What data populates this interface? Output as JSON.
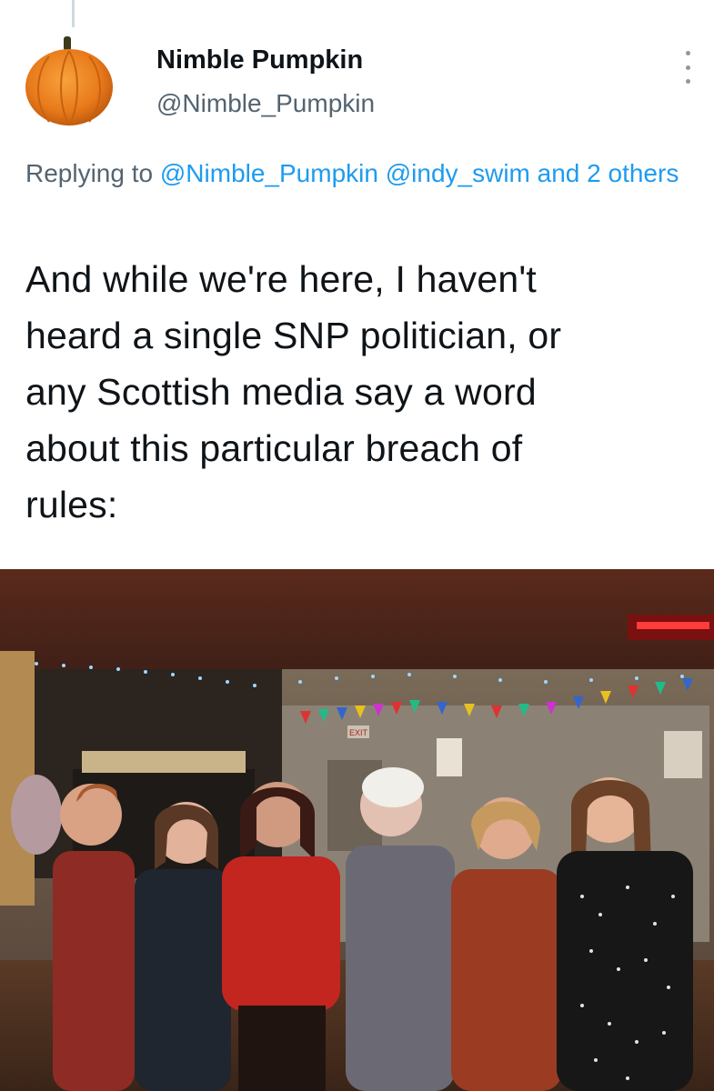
{
  "tweet": {
    "author": {
      "display_name": "Nimble Pumpkin",
      "handle": "@Nimble_Pumpkin",
      "avatar_icon": "pumpkin-avatar"
    },
    "more_icon": "more-dots-icon",
    "reply": {
      "prefix": "Replying to",
      "mention_1": "@Nimble_Pumpkin",
      "mention_2": "@indy_swim",
      "suffix": "and 2 others"
    },
    "text_lines": [
      "And while we're here, I haven't",
      "heard a single SNP politician, or",
      "any Scottish media say a word",
      "about this particular breach of",
      "rules:"
    ],
    "photo": {
      "description_icon": "party-photo",
      "exit_sign": "EXIT"
    }
  },
  "colors": {
    "link": "#1d9bf0",
    "secondary_text": "#536471",
    "primary_text": "#0f1419"
  }
}
